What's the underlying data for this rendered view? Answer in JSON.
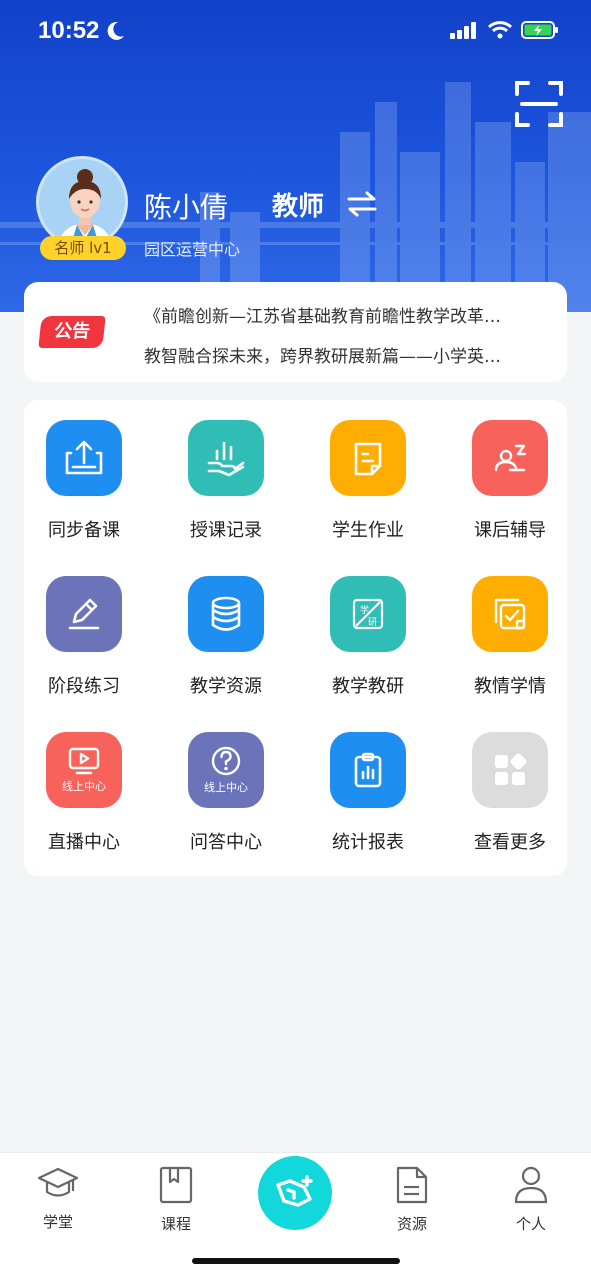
{
  "status_bar": {
    "time": "10:52"
  },
  "profile": {
    "name": "陈小倩",
    "role": "教师",
    "organization": "园区运营中心",
    "level_badge": "名师 lv1"
  },
  "notice": {
    "tag": "公告",
    "items": [
      "《前瞻创新—江苏省基础教育前瞻性教学改革…",
      "教智融合探未来，跨界教研展新篇——小学英…"
    ]
  },
  "menu": {
    "items": [
      {
        "label": "同步备课",
        "icon": "upload-tray-icon",
        "color": "#1e8ef0"
      },
      {
        "label": "授课记录",
        "icon": "hand-chart-icon",
        "color": "#2fbdb5"
      },
      {
        "label": "学生作业",
        "icon": "note-icon",
        "color": "#ffae00"
      },
      {
        "label": "课后辅导",
        "icon": "tutor-icon",
        "color": "#f7635a"
      },
      {
        "label": "阶段练习",
        "icon": "pencil-icon",
        "color": "#6b74b8"
      },
      {
        "label": "教学资源",
        "icon": "database-icon",
        "color": "#1e8ef0"
      },
      {
        "label": "教学教研",
        "icon": "research-icon",
        "color": "#2fbdb5"
      },
      {
        "label": "教情学情",
        "icon": "checklist-icon",
        "color": "#ffae00"
      },
      {
        "label": "直播中心",
        "icon": "live-tv-icon",
        "color": "#f7635a",
        "sub": "线上中心"
      },
      {
        "label": "问答中心",
        "icon": "question-icon",
        "color": "#6b74b8",
        "sub": "线上中心"
      },
      {
        "label": "统计报表",
        "icon": "clipboard-chart-icon",
        "color": "#1e8ef0"
      },
      {
        "label": "查看更多",
        "icon": "more-apps-icon",
        "color": "#dcdcdc"
      }
    ]
  },
  "tabbar": {
    "items": [
      {
        "label": "学堂",
        "icon": "graduation-cap-icon"
      },
      {
        "label": "课程",
        "icon": "bookmark-book-icon"
      },
      {
        "label": "资源",
        "icon": "document-icon"
      },
      {
        "label": "个人",
        "icon": "person-icon"
      }
    ],
    "center_icon": "ai-center-icon"
  }
}
